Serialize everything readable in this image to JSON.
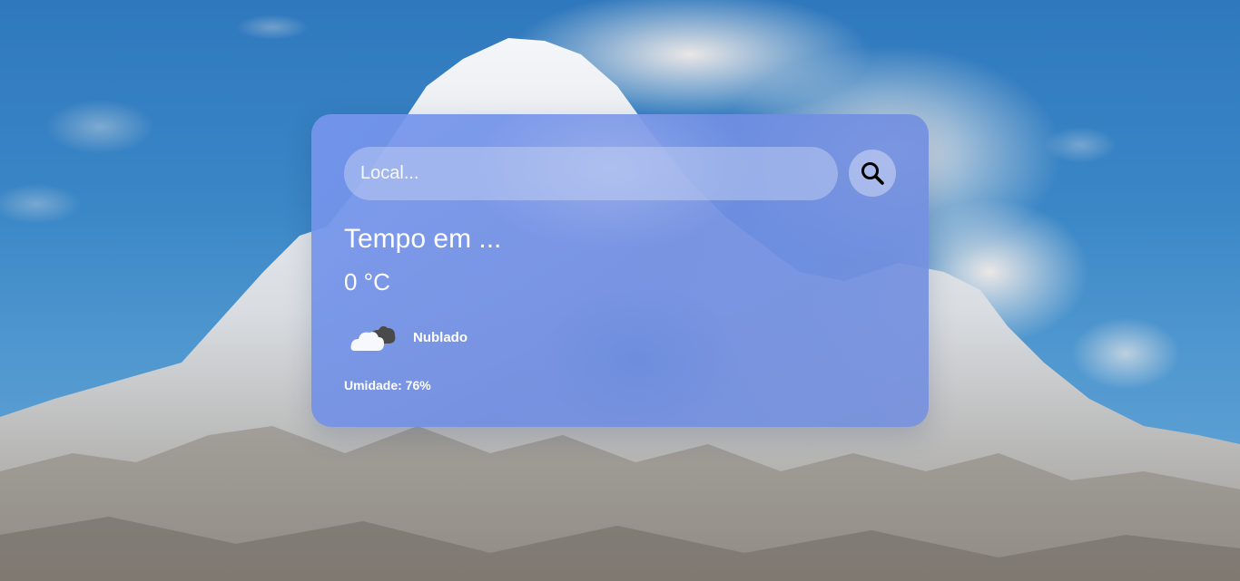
{
  "search": {
    "placeholder": "Local...",
    "button_icon": "search-icon"
  },
  "weather": {
    "city_title": "Tempo em ...",
    "temperature": "0 °C",
    "icon": "cloudy-icon",
    "description": "Nublado",
    "humidity": "Umidade: 76%"
  },
  "colors": {
    "card_background": "#7591e6",
    "text": "#ffffff",
    "sky": "#3a86c6"
  }
}
